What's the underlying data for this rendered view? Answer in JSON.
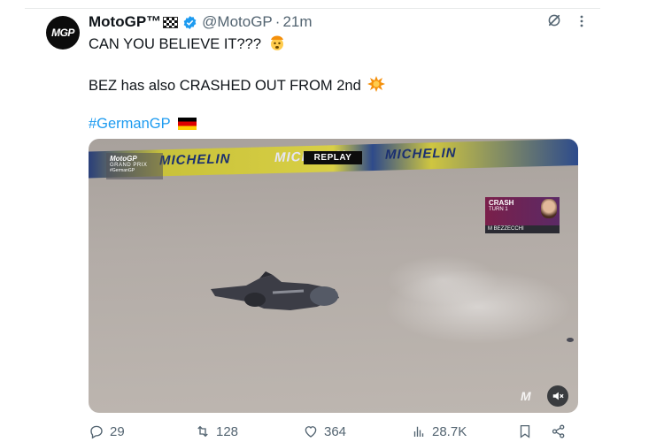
{
  "post": {
    "display_name": "MotoGP™",
    "handle": "@MotoGP",
    "separator": "·",
    "time": "21m",
    "avatar_text": "MGP",
    "line1": "CAN YOU BELIEVE IT???",
    "line2": "BEZ has also CRASHED OUT FROM 2nd",
    "hashtag": "#GermanGP"
  },
  "video": {
    "banner_text": "MICHELIN",
    "logo_main": "MotoGP",
    "logo_sub": "GRAND PRIX",
    "logo_tag": "#GermanGP",
    "replay_label": "REPLAY",
    "crash_title": "CRASH",
    "crash_turn": "TURN 1",
    "crash_rider": "M BEZZECCHI",
    "watermark": "M",
    "mute_icon": "speaker-muted-icon"
  },
  "actions": {
    "replies": "29",
    "reposts": "128",
    "likes": "364",
    "views": "28.7K"
  },
  "colors": {
    "accent": "#1d9bf0",
    "muted_text": "#536471",
    "primary_text": "#0f1419"
  }
}
